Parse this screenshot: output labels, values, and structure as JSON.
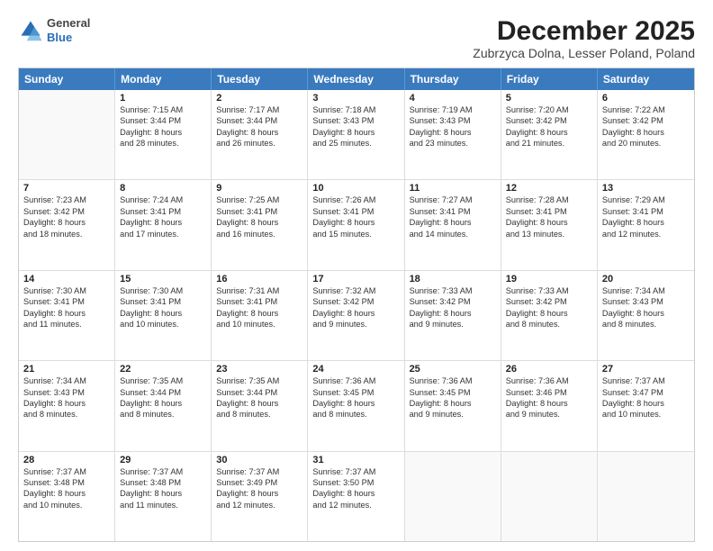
{
  "logo": {
    "general": "General",
    "blue": "Blue"
  },
  "title": "December 2025",
  "subtitle": "Zubrzyca Dolna, Lesser Poland, Poland",
  "header_days": [
    "Sunday",
    "Monday",
    "Tuesday",
    "Wednesday",
    "Thursday",
    "Friday",
    "Saturday"
  ],
  "weeks": [
    [
      {
        "day": "",
        "sunrise": "",
        "sunset": "",
        "daylight": ""
      },
      {
        "day": "1",
        "sunrise": "Sunrise: 7:15 AM",
        "sunset": "Sunset: 3:44 PM",
        "daylight": "Daylight: 8 hours and 28 minutes."
      },
      {
        "day": "2",
        "sunrise": "Sunrise: 7:17 AM",
        "sunset": "Sunset: 3:44 PM",
        "daylight": "Daylight: 8 hours and 26 minutes."
      },
      {
        "day": "3",
        "sunrise": "Sunrise: 7:18 AM",
        "sunset": "Sunset: 3:43 PM",
        "daylight": "Daylight: 8 hours and 25 minutes."
      },
      {
        "day": "4",
        "sunrise": "Sunrise: 7:19 AM",
        "sunset": "Sunset: 3:43 PM",
        "daylight": "Daylight: 8 hours and 23 minutes."
      },
      {
        "day": "5",
        "sunrise": "Sunrise: 7:20 AM",
        "sunset": "Sunset: 3:42 PM",
        "daylight": "Daylight: 8 hours and 21 minutes."
      },
      {
        "day": "6",
        "sunrise": "Sunrise: 7:22 AM",
        "sunset": "Sunset: 3:42 PM",
        "daylight": "Daylight: 8 hours and 20 minutes."
      }
    ],
    [
      {
        "day": "7",
        "sunrise": "Sunrise: 7:23 AM",
        "sunset": "Sunset: 3:42 PM",
        "daylight": "Daylight: 8 hours and 18 minutes."
      },
      {
        "day": "8",
        "sunrise": "Sunrise: 7:24 AM",
        "sunset": "Sunset: 3:41 PM",
        "daylight": "Daylight: 8 hours and 17 minutes."
      },
      {
        "day": "9",
        "sunrise": "Sunrise: 7:25 AM",
        "sunset": "Sunset: 3:41 PM",
        "daylight": "Daylight: 8 hours and 16 minutes."
      },
      {
        "day": "10",
        "sunrise": "Sunrise: 7:26 AM",
        "sunset": "Sunset: 3:41 PM",
        "daylight": "Daylight: 8 hours and 15 minutes."
      },
      {
        "day": "11",
        "sunrise": "Sunrise: 7:27 AM",
        "sunset": "Sunset: 3:41 PM",
        "daylight": "Daylight: 8 hours and 14 minutes."
      },
      {
        "day": "12",
        "sunrise": "Sunrise: 7:28 AM",
        "sunset": "Sunset: 3:41 PM",
        "daylight": "Daylight: 8 hours and 13 minutes."
      },
      {
        "day": "13",
        "sunrise": "Sunrise: 7:29 AM",
        "sunset": "Sunset: 3:41 PM",
        "daylight": "Daylight: 8 hours and 12 minutes."
      }
    ],
    [
      {
        "day": "14",
        "sunrise": "Sunrise: 7:30 AM",
        "sunset": "Sunset: 3:41 PM",
        "daylight": "Daylight: 8 hours and 11 minutes."
      },
      {
        "day": "15",
        "sunrise": "Sunrise: 7:30 AM",
        "sunset": "Sunset: 3:41 PM",
        "daylight": "Daylight: 8 hours and 10 minutes."
      },
      {
        "day": "16",
        "sunrise": "Sunrise: 7:31 AM",
        "sunset": "Sunset: 3:41 PM",
        "daylight": "Daylight: 8 hours and 10 minutes."
      },
      {
        "day": "17",
        "sunrise": "Sunrise: 7:32 AM",
        "sunset": "Sunset: 3:42 PM",
        "daylight": "Daylight: 8 hours and 9 minutes."
      },
      {
        "day": "18",
        "sunrise": "Sunrise: 7:33 AM",
        "sunset": "Sunset: 3:42 PM",
        "daylight": "Daylight: 8 hours and 9 minutes."
      },
      {
        "day": "19",
        "sunrise": "Sunrise: 7:33 AM",
        "sunset": "Sunset: 3:42 PM",
        "daylight": "Daylight: 8 hours and 8 minutes."
      },
      {
        "day": "20",
        "sunrise": "Sunrise: 7:34 AM",
        "sunset": "Sunset: 3:43 PM",
        "daylight": "Daylight: 8 hours and 8 minutes."
      }
    ],
    [
      {
        "day": "21",
        "sunrise": "Sunrise: 7:34 AM",
        "sunset": "Sunset: 3:43 PM",
        "daylight": "Daylight: 8 hours and 8 minutes."
      },
      {
        "day": "22",
        "sunrise": "Sunrise: 7:35 AM",
        "sunset": "Sunset: 3:44 PM",
        "daylight": "Daylight: 8 hours and 8 minutes."
      },
      {
        "day": "23",
        "sunrise": "Sunrise: 7:35 AM",
        "sunset": "Sunset: 3:44 PM",
        "daylight": "Daylight: 8 hours and 8 minutes."
      },
      {
        "day": "24",
        "sunrise": "Sunrise: 7:36 AM",
        "sunset": "Sunset: 3:45 PM",
        "daylight": "Daylight: 8 hours and 8 minutes."
      },
      {
        "day": "25",
        "sunrise": "Sunrise: 7:36 AM",
        "sunset": "Sunset: 3:45 PM",
        "daylight": "Daylight: 8 hours and 9 minutes."
      },
      {
        "day": "26",
        "sunrise": "Sunrise: 7:36 AM",
        "sunset": "Sunset: 3:46 PM",
        "daylight": "Daylight: 8 hours and 9 minutes."
      },
      {
        "day": "27",
        "sunrise": "Sunrise: 7:37 AM",
        "sunset": "Sunset: 3:47 PM",
        "daylight": "Daylight: 8 hours and 10 minutes."
      }
    ],
    [
      {
        "day": "28",
        "sunrise": "Sunrise: 7:37 AM",
        "sunset": "Sunset: 3:48 PM",
        "daylight": "Daylight: 8 hours and 10 minutes."
      },
      {
        "day": "29",
        "sunrise": "Sunrise: 7:37 AM",
        "sunset": "Sunset: 3:48 PM",
        "daylight": "Daylight: 8 hours and 11 minutes."
      },
      {
        "day": "30",
        "sunrise": "Sunrise: 7:37 AM",
        "sunset": "Sunset: 3:49 PM",
        "daylight": "Daylight: 8 hours and 12 minutes."
      },
      {
        "day": "31",
        "sunrise": "Sunrise: 7:37 AM",
        "sunset": "Sunset: 3:50 PM",
        "daylight": "Daylight: 8 hours and 12 minutes."
      },
      {
        "day": "",
        "sunrise": "",
        "sunset": "",
        "daylight": ""
      },
      {
        "day": "",
        "sunrise": "",
        "sunset": "",
        "daylight": ""
      },
      {
        "day": "",
        "sunrise": "",
        "sunset": "",
        "daylight": ""
      }
    ]
  ]
}
